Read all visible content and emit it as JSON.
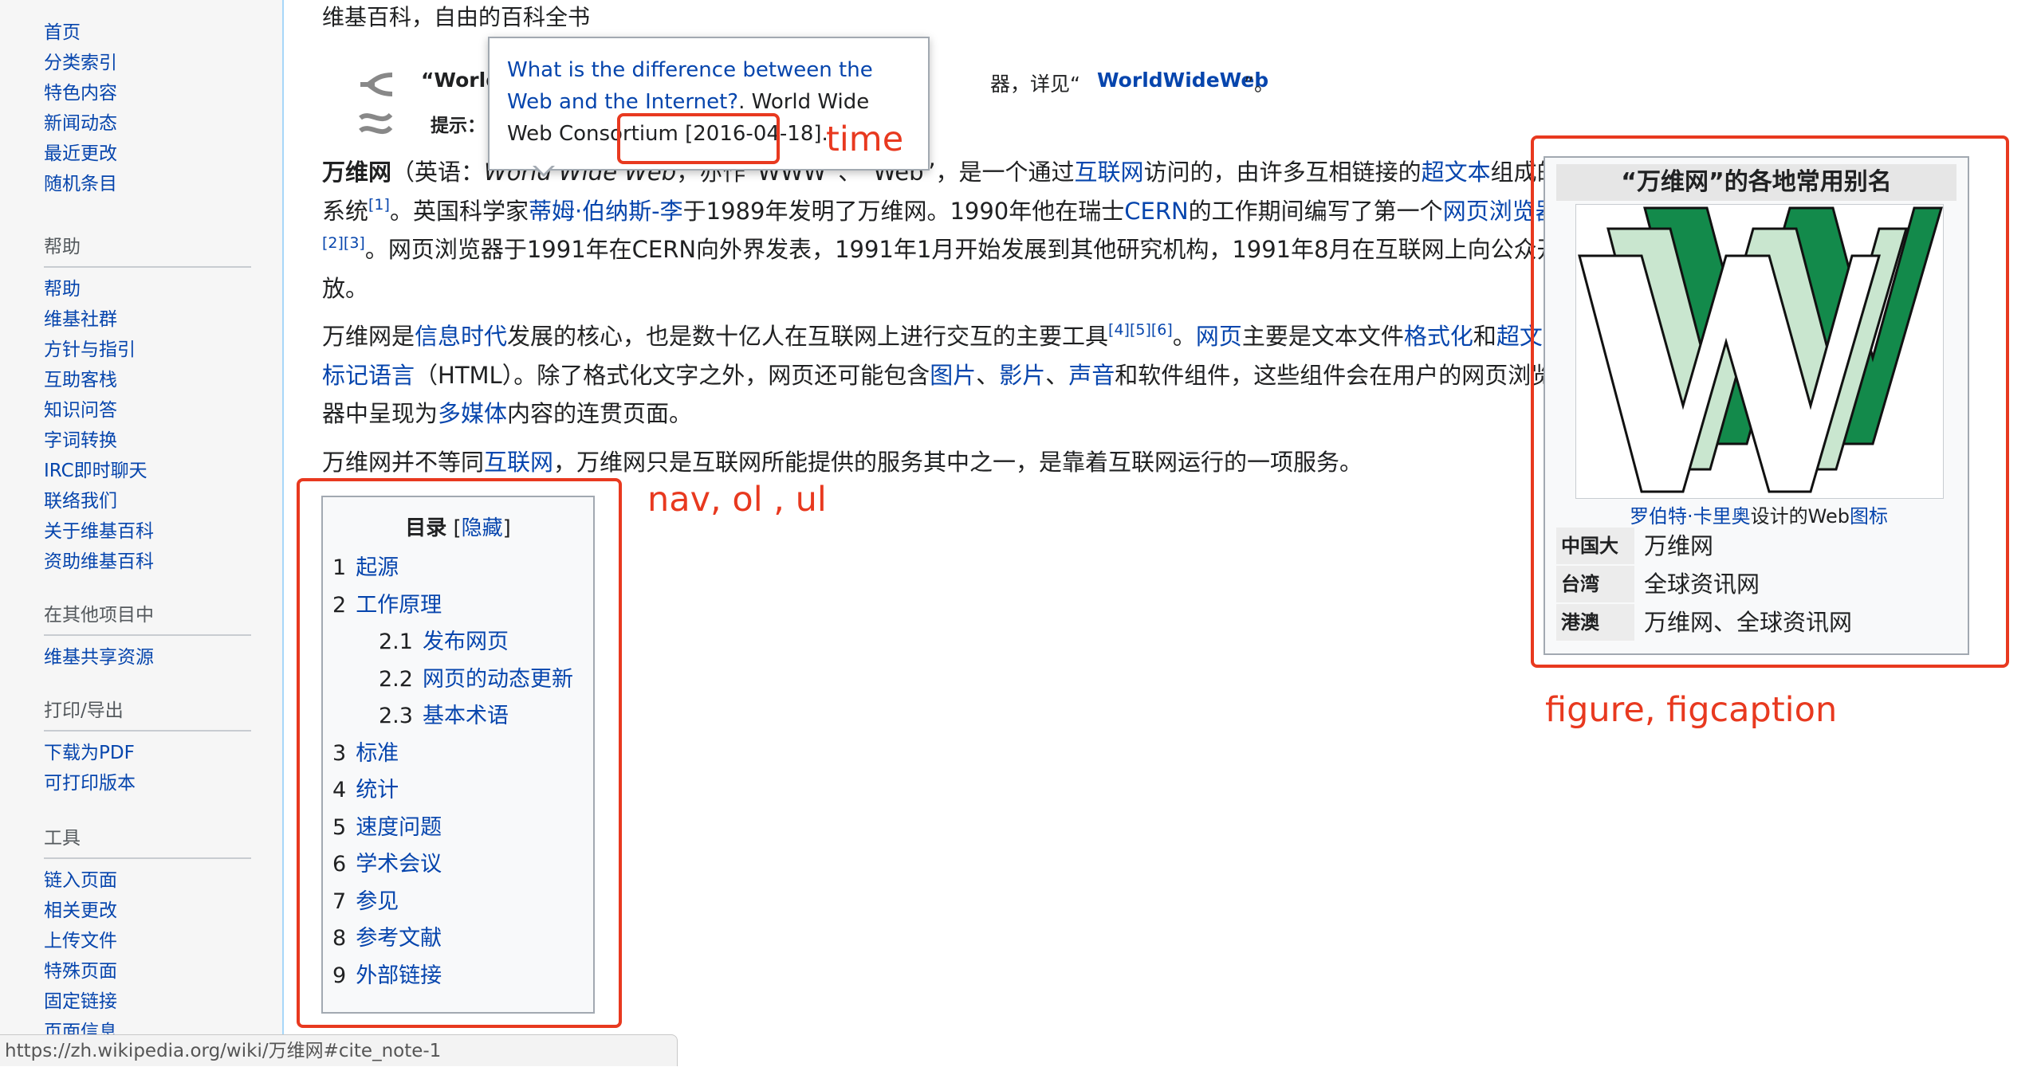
{
  "sidebar": {
    "main": [
      "首页",
      "分类索引",
      "特色内容",
      "新闻动态",
      "最近更改",
      "随机条目"
    ],
    "help": {
      "title": "帮助",
      "items": [
        "帮助",
        "维基社群",
        "方针与指引",
        "互助客栈",
        "知识问答",
        "字词转换",
        "IRC即时聊天",
        "联络我们",
        "关于维基百科",
        "资助维基百科"
      ]
    },
    "other_projects": {
      "title": "在其他项目中",
      "items": [
        "维基共享资源"
      ]
    },
    "print": {
      "title": "打印/导出",
      "items": [
        "下载为PDF",
        "可打印版本"
      ]
    },
    "tools": {
      "title": "工具",
      "items": [
        "链入页面",
        "相关更改",
        "上传文件",
        "特殊页面",
        "固定链接",
        "页面信息"
      ]
    }
  },
  "tagline": "维基百科，自由的百科全书",
  "hatnote": {
    "l1_pre": "“World",
    "l1_tail": "器，详见“",
    "l1_link": "WorldWideWeb",
    "l1_end": "”。",
    "l2": "提示："
  },
  "tooltip": {
    "title_link": "What is the difference between the Web and the Internet?",
    "publisher": ". World Wide Web Consortium",
    "date": "[2016-04-18]",
    "end": "."
  },
  "para1": {
    "bold": "万维网",
    "t1": "（英语：",
    "en": "World Wide Web",
    "t2": "，亦作“WWW”、“Web”，是一个通过",
    "l_internet": "互联网",
    "t3": "访问的，由许多互相链接的",
    "l_hypertext": "超文本",
    "t4": "组成的系统",
    "c1": "[1]",
    "t5": "。英国科学家",
    "l_tbl": "蒂姆·伯纳斯-李",
    "t6": "于1989年发明了万维网。1990年他在瑞士",
    "l_cern": "CERN",
    "t7": "的工作期间编写了第一个",
    "l_browser": "网页浏览器",
    "c2": "[2]",
    "c3": "[3]",
    "t8": "。网页浏览器于1991年在CERN向外界发表，1991年1月开始发展到其他研究机构，1991年8月在互联网上向公众开放。"
  },
  "para2": {
    "t1": "万维网是",
    "l_info_age": "信息时代",
    "t2": "发展的核心，也是数十亿人在互联网上进行交互的主要工具",
    "c4": "[4]",
    "c5": "[5]",
    "c6": "[6]",
    "t3": "。",
    "l_webpage": "网页",
    "t4": "主要是文本文件",
    "l_format": "格式化",
    "t5": "和",
    "l_html": "超文本标记语言",
    "t6": "（HTML）。除了格式化文字之外，网页还可能包含",
    "l_image": "图片",
    "sep1": "、",
    "l_video": "影片",
    "sep2": "、",
    "l_audio": "声音",
    "t7": "和软件组件，这些组件会在用户的网页浏览器中呈现为",
    "l_multimedia": "多媒体",
    "t8": "内容的连贯页面。"
  },
  "para3": {
    "t1": "万维网并不等同",
    "l_internet": "互联网",
    "t2": "，万维网只是互联网所能提供的服务其中之一，是靠着互联网运行的一项服务。"
  },
  "toc": {
    "title": "目录",
    "toggle_open": "[",
    "toggle": "隐藏",
    "toggle_close": "]",
    "items": [
      {
        "num": "1",
        "label": "起源"
      },
      {
        "num": "2",
        "label": "工作原理"
      },
      {
        "num": "2.1",
        "label": "发布网页"
      },
      {
        "num": "2.2",
        "label": "网页的动态更新"
      },
      {
        "num": "2.3",
        "label": "基本术语"
      },
      {
        "num": "3",
        "label": "标准"
      },
      {
        "num": "4",
        "label": "统计"
      },
      {
        "num": "5",
        "label": "速度问题"
      },
      {
        "num": "6",
        "label": "学术会议"
      },
      {
        "num": "7",
        "label": "参见"
      },
      {
        "num": "8",
        "label": "参考文献"
      },
      {
        "num": "9",
        "label": "外部链接"
      }
    ]
  },
  "infobox": {
    "title": "“万维网”的各地常用别名",
    "caption_link1": "罗伯特·卡里奥",
    "caption_text": "设计的Web",
    "caption_link2": "图标",
    "rows": [
      {
        "label": "中国大陆",
        "value": "万维网"
      },
      {
        "label": "台湾",
        "value": "全球资讯网"
      },
      {
        "label": "港澳",
        "value": "万维网、全球资讯网"
      }
    ]
  },
  "annotations": {
    "time": "time",
    "nav": "nav, ol , ul",
    "figure": "figure, figcaption"
  },
  "status_url": "https://zh.wikipedia.org/wiki/万维网#cite_note-1",
  "colors": {
    "link": "#0645ad",
    "annotation": "#e8391f",
    "logo_green": "#138a4b",
    "logo_light": "#c9e6cf"
  }
}
